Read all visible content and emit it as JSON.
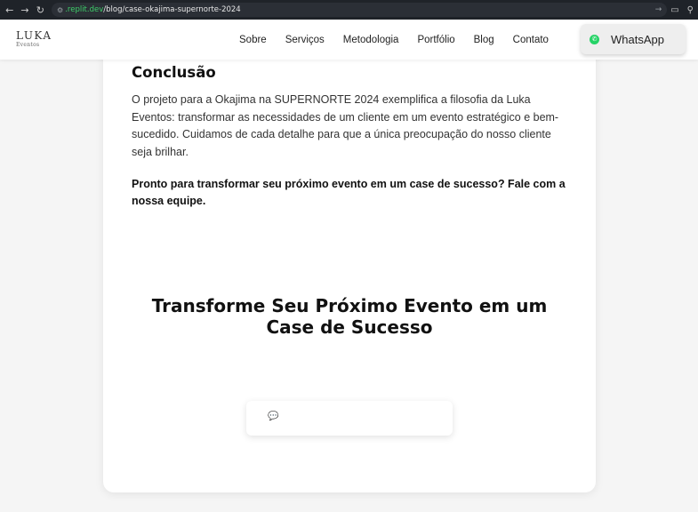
{
  "browser": {
    "back_icon": "back-arrow-icon",
    "forward_icon": "forward-arrow-icon",
    "reload_icon": "reload-icon",
    "url_host": ".replit.dev",
    "url_path": "/blog/case-okajima-supernorte-2024"
  },
  "header": {
    "logo_main": "LUKA",
    "logo_sub": "Eventos",
    "nav": [
      "Sobre",
      "Serviços",
      "Metodologia",
      "Portfólio",
      "Blog",
      "Contato"
    ],
    "whatsapp_label": "WhatsApp",
    "whatsapp_color": "#25d366"
  },
  "article": {
    "conclusion_title": "Conclusão",
    "conclusion_body": "O projeto para a Okajima na SUPERNORTE 2024 exemplifica a filosofia da Luka Eventos: transformar as necessidades de um cliente em um evento estratégico e bem-sucedido. Cuidamos de cada detalhe para que a única preocupação do nosso cliente seja brilhar.",
    "cta_text": "Pronto para transformar seu próximo evento em um case de sucesso? Fale com a nossa equipe."
  },
  "cta_section": {
    "heading_line1": "Transforme Seu Próximo Evento em um",
    "heading_line2": "Case de Sucesso",
    "chat_icon": "speech-bubble-icon"
  }
}
